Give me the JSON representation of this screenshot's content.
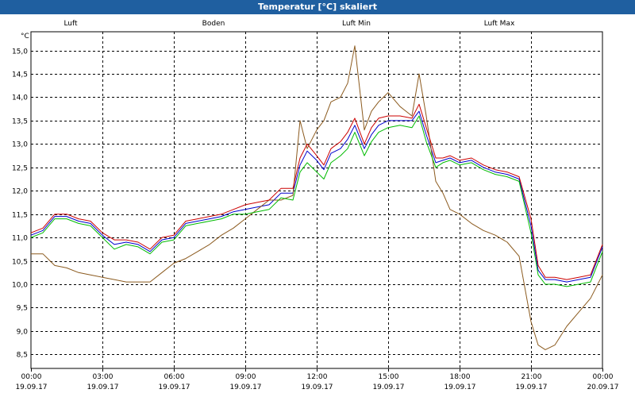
{
  "window": {
    "title": "Temperatur [°C] skaliert"
  },
  "colors": {
    "titlebar": "#1f5fa0",
    "grid": "#000000"
  },
  "chart_data": {
    "type": "line",
    "title": "Temperatur [°C] skaliert",
    "ylabel": "°C",
    "ylim": [
      8.2,
      15.4
    ],
    "yticks": [
      8.5,
      9.0,
      9.5,
      10.0,
      10.5,
      11.0,
      11.5,
      12.0,
      12.5,
      13.0,
      13.5,
      14.0,
      14.5,
      15.0
    ],
    "ytick_labels": [
      "8,5",
      "9,0",
      "9,5",
      "10,0",
      "10,5",
      "11,0",
      "11,5",
      "12,0",
      "12,5",
      "13,0",
      "13,5",
      "14,0",
      "14,5",
      "15,0"
    ],
    "xlim_hours": [
      0,
      24
    ],
    "x_unit": "hours since 00:00 19.09.17",
    "xticks": [
      {
        "hours": 0,
        "time": "00:00",
        "date": "19.09.17"
      },
      {
        "hours": 3,
        "time": "03:00",
        "date": "19.09.17"
      },
      {
        "hours": 6,
        "time": "06:00",
        "date": "19.09.17"
      },
      {
        "hours": 9,
        "time": "09:00",
        "date": "19.09.17"
      },
      {
        "hours": 12,
        "time": "12:00",
        "date": "19.09.17"
      },
      {
        "hours": 15,
        "time": "15:00",
        "date": "19.09.17"
      },
      {
        "hours": 18,
        "time": "18:00",
        "date": "19.09.17"
      },
      {
        "hours": 21,
        "time": "21:00",
        "date": "19.09.17"
      },
      {
        "hours": 24,
        "time": "00:00",
        "date": "20.09.17"
      }
    ],
    "grid": true,
    "legend_position": "top",
    "series": [
      {
        "name": "Luft",
        "color": "#0000cc",
        "x": [
          0,
          0.5,
          1,
          1.5,
          2,
          2.5,
          3,
          3.5,
          4,
          4.5,
          5,
          5.5,
          6,
          6.5,
          7,
          7.5,
          8,
          8.5,
          9,
          9.5,
          10,
          10.5,
          11,
          11.3,
          11.6,
          12,
          12.3,
          12.6,
          13,
          13.3,
          13.6,
          14,
          14.3,
          14.6,
          15,
          15.5,
          16,
          16.3,
          16.6,
          17,
          17.3,
          17.6,
          18,
          18.5,
          19,
          19.5,
          20,
          20.5,
          21,
          21.3,
          21.6,
          22,
          22.5,
          23,
          23.5,
          24
        ],
        "y": [
          11.05,
          11.15,
          11.45,
          11.45,
          11.35,
          11.3,
          11.05,
          10.85,
          10.9,
          10.85,
          10.7,
          10.95,
          11.0,
          11.3,
          11.35,
          11.4,
          11.45,
          11.55,
          11.6,
          11.65,
          11.7,
          11.95,
          11.95,
          12.55,
          12.85,
          12.65,
          12.45,
          12.8,
          12.9,
          13.1,
          13.4,
          12.9,
          13.2,
          13.4,
          13.5,
          13.5,
          13.5,
          13.7,
          13.2,
          12.6,
          12.65,
          12.7,
          12.6,
          12.65,
          12.5,
          12.4,
          12.35,
          12.25,
          11.25,
          10.3,
          10.1,
          10.1,
          10.05,
          10.1,
          10.15,
          10.8
        ]
      },
      {
        "name": "Boden",
        "color": "#8b5a1e",
        "x": [
          0,
          0.5,
          1,
          1.5,
          2,
          2.5,
          3,
          3.5,
          4,
          4.5,
          5,
          5.5,
          6,
          6.5,
          7,
          7.5,
          8,
          8.5,
          9,
          9.5,
          10,
          10.5,
          11,
          11.3,
          11.6,
          12,
          12.3,
          12.6,
          13,
          13.3,
          13.6,
          14,
          14.3,
          14.6,
          15,
          15.5,
          16,
          16.3,
          16.6,
          17,
          17.3,
          17.6,
          18,
          18.5,
          19,
          19.5,
          20,
          20.5,
          21,
          21.3,
          21.6,
          22,
          22.5,
          23,
          23.5,
          24
        ],
        "y": [
          10.65,
          10.65,
          10.4,
          10.35,
          10.25,
          10.2,
          10.15,
          10.1,
          10.05,
          10.05,
          10.05,
          10.25,
          10.45,
          10.55,
          10.7,
          10.85,
          11.05,
          11.2,
          11.4,
          11.6,
          11.8,
          11.8,
          11.9,
          13.5,
          12.9,
          13.3,
          13.5,
          13.9,
          14.0,
          14.3,
          15.1,
          13.3,
          13.7,
          13.9,
          14.1,
          13.8,
          13.6,
          14.5,
          13.6,
          12.2,
          11.95,
          11.6,
          11.5,
          11.3,
          11.15,
          11.05,
          10.9,
          10.6,
          9.2,
          8.7,
          8.6,
          8.7,
          9.1,
          9.4,
          9.7,
          10.2
        ]
      },
      {
        "name": "Luft Min",
        "color": "#00bb00",
        "x": [
          0,
          0.5,
          1,
          1.5,
          2,
          2.5,
          3,
          3.5,
          4,
          4.5,
          5,
          5.5,
          6,
          6.5,
          7,
          7.5,
          8,
          8.5,
          9,
          9.5,
          10,
          10.5,
          11,
          11.3,
          11.6,
          12,
          12.3,
          12.6,
          13,
          13.3,
          13.6,
          14,
          14.3,
          14.6,
          15,
          15.5,
          16,
          16.3,
          16.6,
          17,
          17.3,
          17.6,
          18,
          18.5,
          19,
          19.5,
          20,
          20.5,
          21,
          21.3,
          21.6,
          22,
          22.5,
          23,
          23.5,
          24
        ],
        "y": [
          11.0,
          11.1,
          11.4,
          11.4,
          11.3,
          11.25,
          11.0,
          10.75,
          10.85,
          10.8,
          10.65,
          10.9,
          10.95,
          11.25,
          11.3,
          11.35,
          11.4,
          11.5,
          11.5,
          11.55,
          11.6,
          11.85,
          11.8,
          12.4,
          12.6,
          12.4,
          12.25,
          12.6,
          12.75,
          12.9,
          13.25,
          12.75,
          13.05,
          13.25,
          13.35,
          13.4,
          13.35,
          13.6,
          13.05,
          12.5,
          12.6,
          12.65,
          12.55,
          12.6,
          12.45,
          12.35,
          12.3,
          12.2,
          11.1,
          10.2,
          10.0,
          10.0,
          9.95,
          10.0,
          10.05,
          10.7
        ]
      },
      {
        "name": "Luft Max",
        "color": "#cc0000",
        "x": [
          0,
          0.5,
          1,
          1.5,
          2,
          2.5,
          3,
          3.5,
          4,
          4.5,
          5,
          5.5,
          6,
          6.5,
          7,
          7.5,
          8,
          8.5,
          9,
          9.5,
          10,
          10.5,
          11,
          11.3,
          11.6,
          12,
          12.3,
          12.6,
          13,
          13.3,
          13.6,
          14,
          14.3,
          14.6,
          15,
          15.5,
          16,
          16.3,
          16.6,
          17,
          17.3,
          17.6,
          18,
          18.5,
          19,
          19.5,
          20,
          20.5,
          21,
          21.3,
          21.6,
          22,
          22.5,
          23,
          23.5,
          24
        ],
        "y": [
          11.1,
          11.2,
          11.5,
          11.5,
          11.4,
          11.35,
          11.1,
          10.95,
          10.95,
          10.9,
          10.75,
          11.0,
          11.05,
          11.35,
          11.4,
          11.45,
          11.5,
          11.6,
          11.7,
          11.75,
          11.8,
          12.05,
          12.05,
          12.7,
          13.0,
          12.75,
          12.55,
          12.9,
          13.05,
          13.25,
          13.55,
          13.0,
          13.35,
          13.55,
          13.6,
          13.6,
          13.55,
          13.85,
          13.35,
          12.7,
          12.7,
          12.75,
          12.65,
          12.7,
          12.55,
          12.45,
          12.4,
          12.3,
          11.4,
          10.4,
          10.15,
          10.15,
          10.1,
          10.15,
          10.2,
          10.85
        ]
      }
    ]
  }
}
